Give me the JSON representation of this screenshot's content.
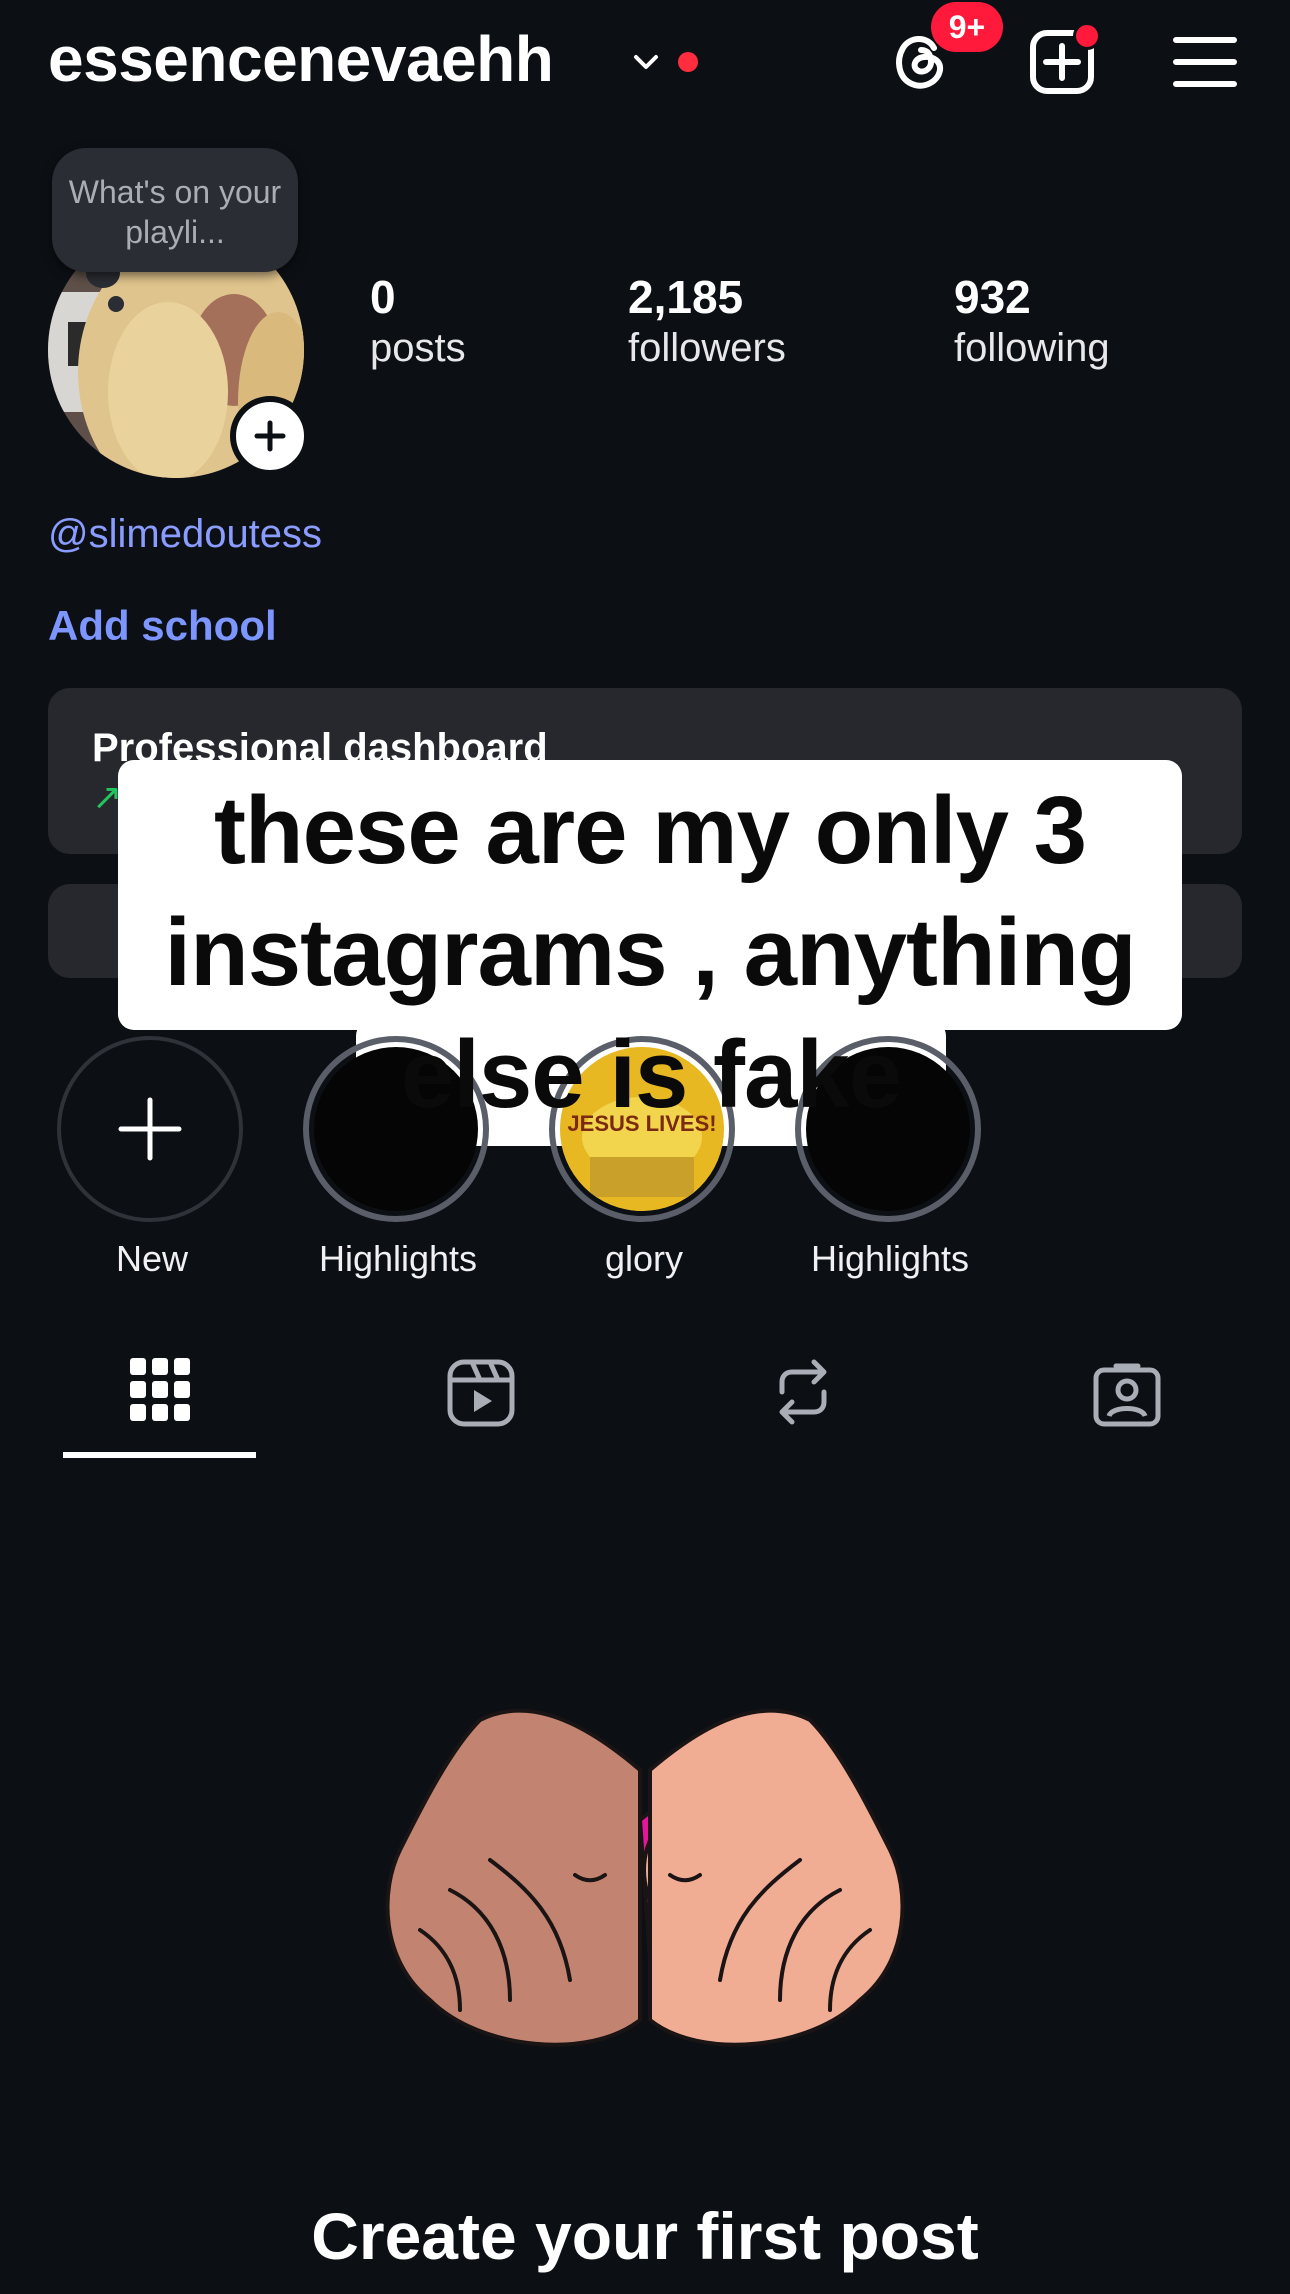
{
  "header": {
    "username": "essencenevaehh",
    "threads_badge": "9+",
    "icons": [
      "chevron-down-icon",
      "threads-icon",
      "create-icon",
      "menu-icon"
    ]
  },
  "profile": {
    "note_text": "What's on your playli...",
    "handle": "@slimedoutess",
    "add_school": "Add school",
    "stats": [
      {
        "value": "0",
        "label": "posts"
      },
      {
        "value": "2,185",
        "label": "followers"
      },
      {
        "value": "932",
        "label": "following"
      }
    ]
  },
  "dashboard": {
    "title": "Professional dashboard"
  },
  "overlay": {
    "line1": "these are my only 3",
    "line2": "instagrams , anything",
    "line3": "else is fake"
  },
  "highlights": [
    {
      "label": "New"
    },
    {
      "label": "Highlights"
    },
    {
      "label": "glory",
      "cover_text": "JESUS LIVES!"
    },
    {
      "label": "Highlights"
    }
  ],
  "tabs": [
    "grid-icon",
    "reels-icon",
    "reposts-icon",
    "tagged-icon"
  ],
  "empty_state": {
    "cta": "Create your first post"
  },
  "colors": {
    "background": "#0c0f14",
    "link": "#7c95ff",
    "badge": "#ff1a3b",
    "card": "#26282e"
  }
}
